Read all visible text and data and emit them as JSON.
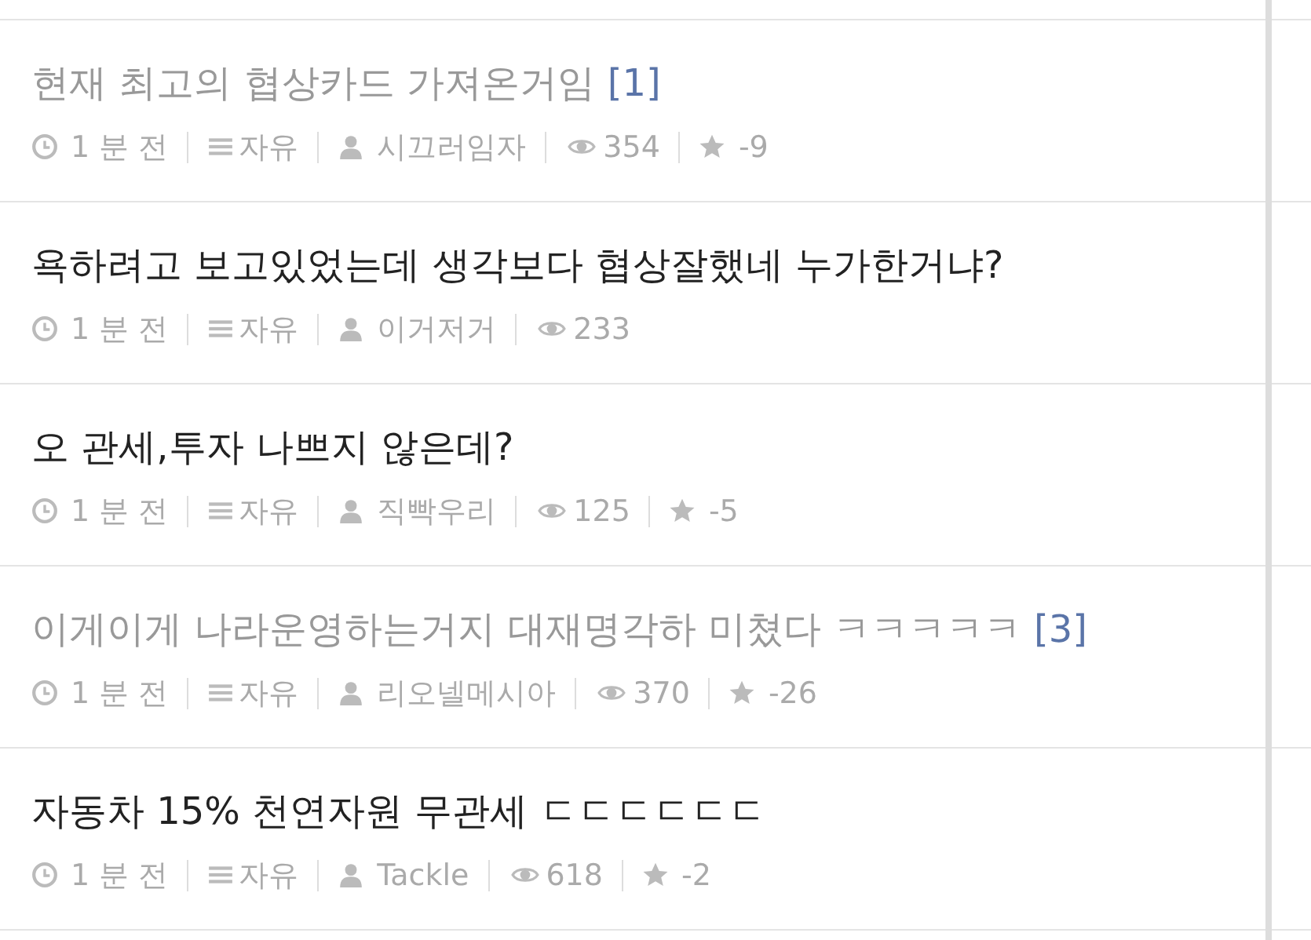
{
  "posts": [
    {
      "title": "현재 최고의 협상카드 가져온거임",
      "read": true,
      "comments": "[1]",
      "time": "1 분 전",
      "board": "자유",
      "author": "시끄러임자",
      "views": "354",
      "score": "-9"
    },
    {
      "title": "욕하려고 보고있었는데 생각보다 협상잘했네 누가한거냐?",
      "read": false,
      "time": "1 분 전",
      "board": "자유",
      "author": "이거저거",
      "views": "233"
    },
    {
      "title": "오 관세,투자 나쁘지 않은데?",
      "read": false,
      "time": "1 분 전",
      "board": "자유",
      "author": "직빡우리",
      "views": "125",
      "score": "-5"
    },
    {
      "title": "이게이게 나라운영하는거지 대재명각하 미쳤다 ㅋㅋㅋㅋㅋ",
      "read": true,
      "comments": "[3]",
      "time": "1 분 전",
      "board": "자유",
      "author": "리오넬메시아",
      "views": "370",
      "score": "-26"
    },
    {
      "title": "자동차 15% 천연자원 무관세 ㄷㄷㄷㄷㄷㄷ",
      "read": false,
      "time": "1 분 전",
      "board": "자유",
      "author": "Tackle",
      "views": "618",
      "score": "-2"
    }
  ]
}
